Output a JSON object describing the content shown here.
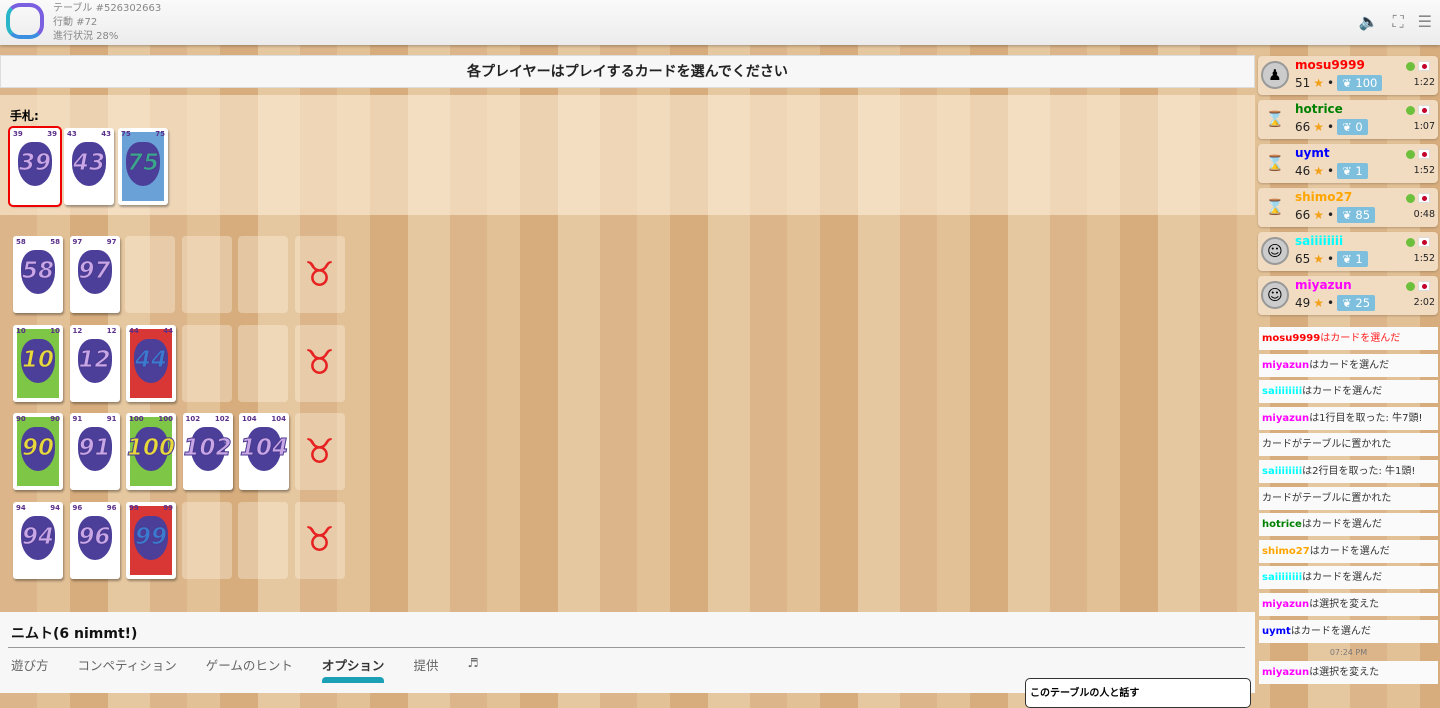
{
  "header": {
    "table": "テーブル #526302663",
    "move": "行動 #72",
    "progress": "進行状況 28%",
    "icons": [
      "speaker-icon",
      "fullscreen-icon",
      "menu-icon"
    ]
  },
  "main": {
    "title": "各プレイヤーはプレイするカードを選んでください",
    "hand_label": "手札:"
  },
  "hand": [
    {
      "n": 39,
      "color": "purple",
      "selected": true
    },
    {
      "n": 43,
      "color": "purple"
    },
    {
      "n": 75,
      "color": "blue"
    }
  ],
  "rows": [
    [
      {
        "n": 58,
        "color": "purple"
      },
      {
        "n": 97,
        "color": "purple"
      }
    ],
    [
      {
        "n": 10,
        "color": "green"
      },
      {
        "n": 12,
        "color": "purple"
      },
      {
        "n": 44,
        "color": "red"
      }
    ],
    [
      {
        "n": 90,
        "color": "green"
      },
      {
        "n": 91,
        "color": "purple"
      },
      {
        "n": 100,
        "color": "green"
      },
      {
        "n": 102,
        "color": "purple"
      },
      {
        "n": 104,
        "color": "purple"
      }
    ],
    [
      {
        "n": 94,
        "color": "purple"
      },
      {
        "n": 96,
        "color": "purple"
      },
      {
        "n": 99,
        "color": "red"
      }
    ]
  ],
  "bottom": {
    "game_name": "ニムト(6 nimmt!)",
    "tabs": [
      "遊び方",
      "コンペティション",
      "ゲームのヒント",
      "オプション",
      "提供",
      "♬"
    ],
    "active_tab": 3
  },
  "players": [
    {
      "name": "mosu9999",
      "color": "#ff0000",
      "rank": "51",
      "laurel": "100",
      "time": "1:22",
      "avatar": "meeple"
    },
    {
      "name": "hotrice",
      "color": "#008000",
      "rank": "66",
      "laurel": "0",
      "time": "1:07",
      "avatar": "hourglass"
    },
    {
      "name": "uymt",
      "color": "#0000ff",
      "rank": "46",
      "laurel": "1",
      "time": "1:52",
      "avatar": "hourglass"
    },
    {
      "name": "shimo27",
      "color": "#ffa500",
      "rank": "66",
      "laurel": "85",
      "time": "0:48",
      "avatar": "hourglass"
    },
    {
      "name": "saiiiiiiii",
      "color": "#00ffff",
      "rank": "65",
      "laurel": "1",
      "time": "1:52",
      "avatar": "photo"
    },
    {
      "name": "miyazun",
      "color": "#ff00ff",
      "rank": "49",
      "laurel": "25",
      "time": "2:02",
      "avatar": "photo"
    }
  ],
  "log": [
    {
      "who": "mosu9999",
      "color": "#ff0000",
      "text": "はカードを選んだ",
      "red": true
    },
    {
      "who": "miyazun",
      "color": "#ff00ff",
      "text": "はカードを選んだ"
    },
    {
      "who": "saiiiiiiii",
      "color": "#00ffff",
      "text": "はカードを選んだ"
    },
    {
      "who": "miyazun",
      "color": "#ff00ff",
      "text": "は1行目を取った: 牛7頭!"
    },
    {
      "who": "",
      "color": "",
      "text": "カードがテーブルに置かれた"
    },
    {
      "who": "saiiiiiiii",
      "color": "#00ffff",
      "text": "は2行目を取った: 牛1頭!"
    },
    {
      "who": "",
      "color": "",
      "text": "カードがテーブルに置かれた"
    },
    {
      "who": "hotrice",
      "color": "#008000",
      "text": "はカードを選んだ"
    },
    {
      "who": "shimo27",
      "color": "#ffa500",
      "text": "はカードを選んだ"
    },
    {
      "who": "saiiiiiiii",
      "color": "#00ffff",
      "text": "はカードを選んだ"
    },
    {
      "who": "miyazun",
      "color": "#ff00ff",
      "text": "は選択を変えた"
    },
    {
      "who": "uymt",
      "color": "#0000ff",
      "text": "はカードを選んだ"
    },
    {
      "timestamp": "07:24 PM"
    },
    {
      "who": "miyazun",
      "color": "#ff00ff",
      "text": "は選択を変えた"
    }
  ],
  "chat": {
    "title": "このテーブルの人と話す"
  }
}
